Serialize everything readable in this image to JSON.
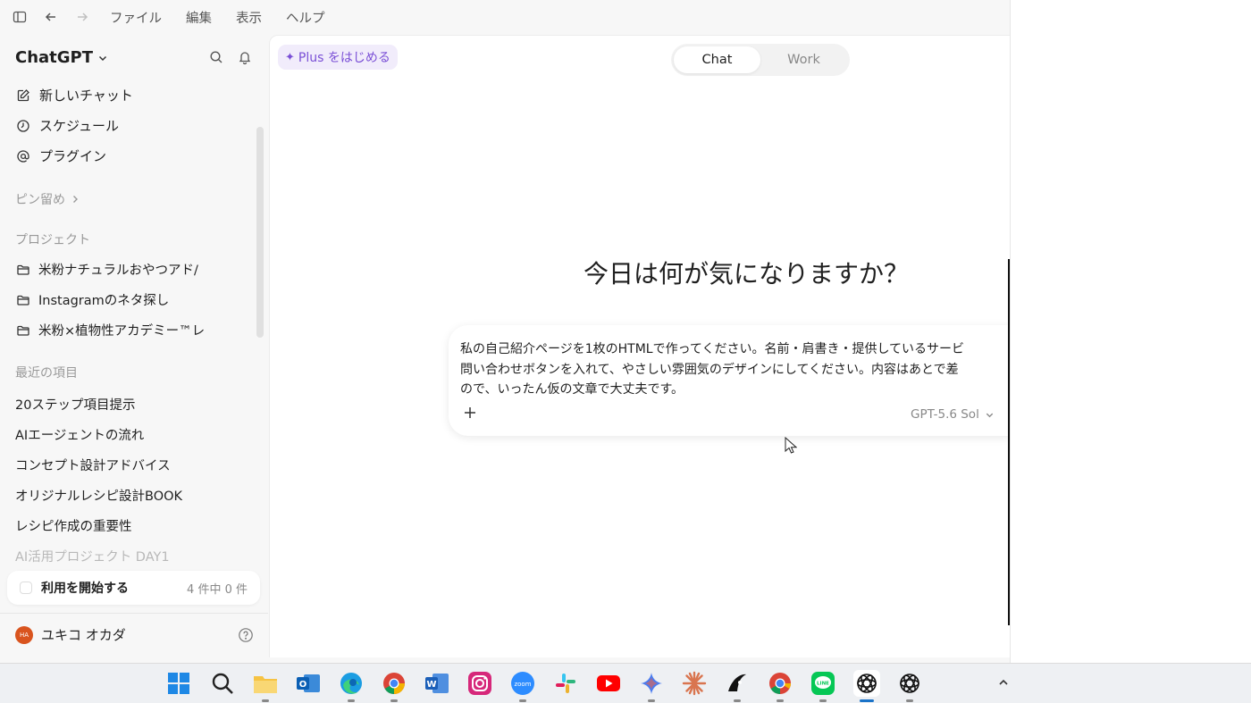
{
  "menu": [
    "ファイル",
    "編集",
    "表示",
    "ヘルプ"
  ],
  "sidebar": {
    "brand": "ChatGPT",
    "nav": [
      {
        "label": "新しいチャット",
        "icon": "edit-icon"
      },
      {
        "label": "スケジュール",
        "icon": "clock-icon"
      },
      {
        "label": "プラグイン",
        "icon": "at-sign-icon"
      }
    ],
    "pinned_label": "ピン留め",
    "projects_label": "プロジェクト",
    "projects": [
      "米粉ナチュラルおやつアド/",
      "Instagramのネタ探し",
      "米粉×植物性アカデミー™レ"
    ],
    "recent_label": "最近の項目",
    "recent": [
      "20ステップ項目提示",
      "AIエージェントの流れ",
      "コンセプト設計アドバイス",
      "オリジナルレシピ設計BOOK",
      "レシピ作成の重要性",
      "AI活用プロジェクト DAY1"
    ],
    "start_card": {
      "label": "利用を開始する",
      "count": "4 件中 0 件"
    },
    "user": {
      "initials": "HA",
      "name": "ユキコ オカダ"
    }
  },
  "main": {
    "plus_button": "Plus をはじめる",
    "tabs": [
      "Chat",
      "Work"
    ],
    "active_tab": "Chat",
    "heading": "今日は何が気になりますか？",
    "composer": {
      "lines": [
        "私の自己紹介ページを1枚のHTMLで作ってください。名前・肩書き・提供しているサービ",
        "問い合わせボタンを入れて、やさしい雰囲気のデザインにしてください。内容はあとで差",
        "ので、いったん仮の文章で大丈夫です。"
      ],
      "model": "GPT-5.6 Sol"
    }
  },
  "taskbar": {
    "apps": [
      "start",
      "search",
      "file-explorer",
      "outlook",
      "edge",
      "chrome",
      "word",
      "instagram",
      "zoom",
      "slack",
      "youtube",
      "gemini",
      "claude",
      "perplexity",
      "chrome-2",
      "line",
      "chatgpt",
      "chatgpt-2"
    ]
  },
  "colors": {
    "accent": "#7a4fd6",
    "plus_bg": "#f1ecfb",
    "avatar": "#d9541e"
  }
}
